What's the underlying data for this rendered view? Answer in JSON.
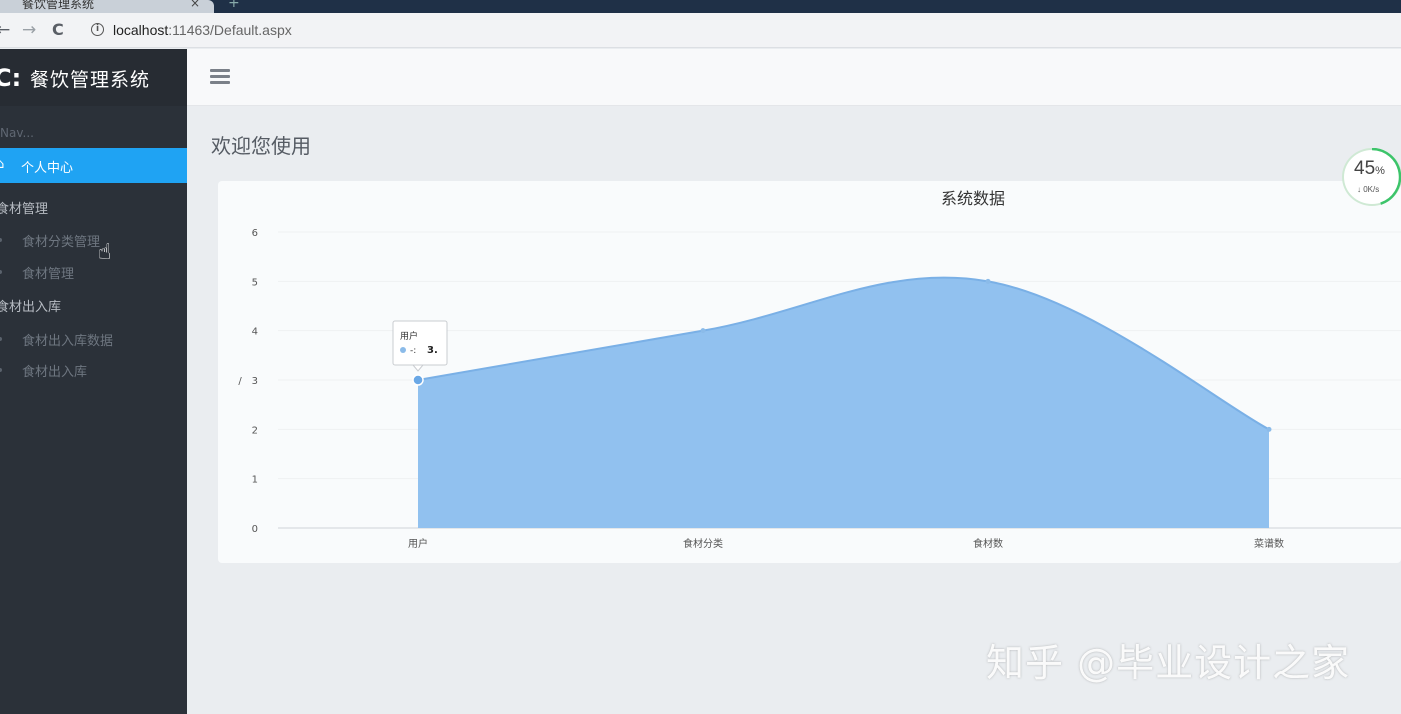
{
  "browser": {
    "tab_title": "餐饮管理系统",
    "tab_close": "×",
    "tab_new": "+",
    "nav": {
      "back": "←",
      "forward": "→",
      "reload": "C"
    },
    "url_host": "localhost",
    "url_rest": ":11463/Default.aspx"
  },
  "sidebar": {
    "brand_title": "餐饮管理系统",
    "caption": "Nav...",
    "active_item": "个人中心",
    "groups": [
      {
        "label": "食材管理",
        "items": [
          "食材分类管理",
          "食材管理"
        ]
      },
      {
        "label": "食材出入库",
        "items": [
          "食材出入库数据",
          "食材出入库"
        ]
      }
    ]
  },
  "page": {
    "heading": "欢迎您使用"
  },
  "net_widget": {
    "percent": "45",
    "percent_unit": "%",
    "speed": "↓ 0K/s"
  },
  "watermark": "知乎 @毕业设计之家",
  "colors": {
    "sidebar_bg": "#2b3139",
    "active": "#1fa3f3",
    "area_fill": "#91c1ef",
    "area_line": "#7ab0e6"
  },
  "chart_data": {
    "type": "area",
    "title": "系统数据",
    "categories": [
      "用户",
      "食材分类",
      "食材数",
      "菜谱数"
    ],
    "values": [
      3,
      4,
      5,
      2
    ],
    "ylim": [
      0,
      6
    ],
    "yticks": [
      "0",
      "1",
      "2",
      "3",
      "4",
      "5",
      "6"
    ],
    "ylabel": "/",
    "smooth": true,
    "grid": true,
    "tooltip": {
      "title": "用户",
      "series": "-",
      "value": "3."
    }
  }
}
